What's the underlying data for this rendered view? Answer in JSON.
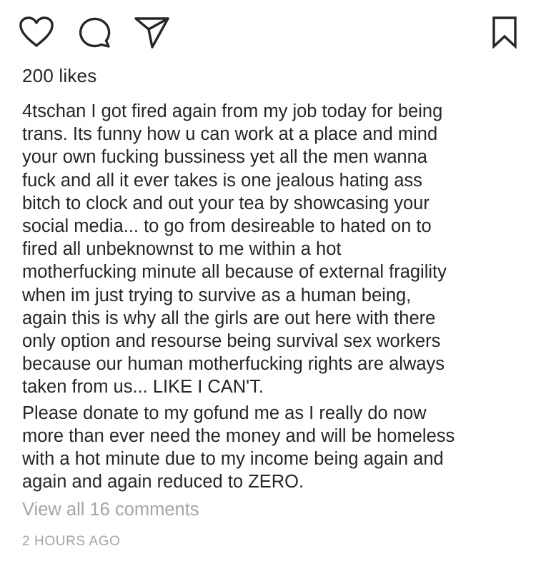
{
  "actions": {
    "like_icon": "heart-icon",
    "comment_icon": "speech-bubble-icon",
    "share_icon": "paper-plane-icon",
    "save_icon": "bookmark-icon"
  },
  "likes_text": "200 likes",
  "caption": {
    "username": "4tschan",
    "paragraph1_lines": [
      "I got fired again from my job today for being",
      "trans. Its funny how u can work at a place and mind",
      "your own fucking bussiness yet all the men wanna",
      "fuck and all it ever takes is one jealous hating ass",
      "bitch to clock and out your tea by showcasing your",
      "social media... to go from desireable to hated on to",
      "fired all unbeknownst to me within a hot",
      "motherfucking minute all because of external fragility",
      "when im just trying to survive as a human being,",
      "again this is why all the girls are out here with there",
      "only option and resourse being survival sex workers",
      "because our human motherfucking rights are always",
      "taken from us... LIKE I CAN'T."
    ],
    "paragraph2_lines": [
      "Please donate to my gofund me as I really do now",
      "more than ever need the money and will be homeless",
      "with a hot minute due to my income being again and",
      "again and again reduced to ZERO."
    ]
  },
  "view_comments_text": "View all 16 comments",
  "timestamp": "2 HOURS AGO",
  "colors": {
    "text": "#262626",
    "muted": "#a5a5a5",
    "background": "#ffffff"
  }
}
